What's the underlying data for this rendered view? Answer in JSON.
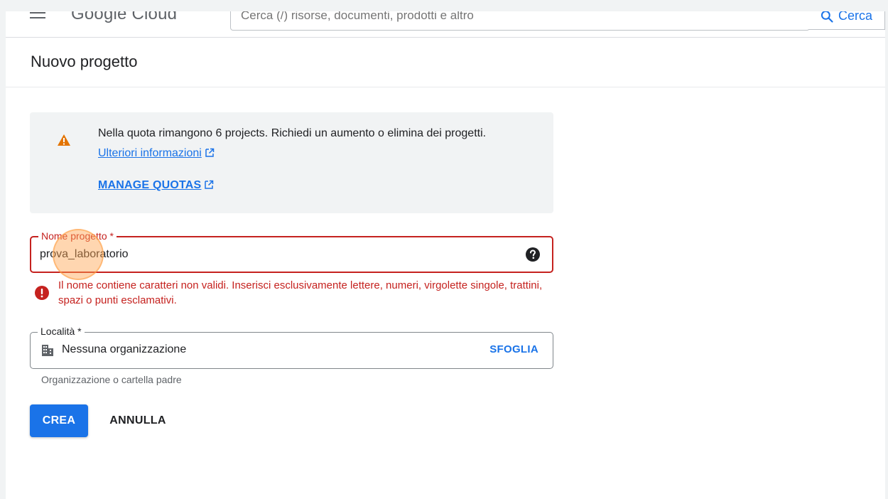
{
  "header": {
    "logo_text": "Google Cloud",
    "search_placeholder": "Cerca (/) risorse, documenti, prodotti e altro",
    "search_button_label": "Cerca"
  },
  "page": {
    "title": "Nuovo progetto"
  },
  "quota_warning": {
    "text": "Nella quota rimangono 6 projects. Richiedi un aumento o elimina dei progetti.",
    "link_label": "Ulteriori informazioni",
    "manage_label": "MANAGE QUOTAS"
  },
  "project_name": {
    "label": "Nome progetto *",
    "value": "prova_laboratorio",
    "error": "Il nome contiene caratteri non validi. Inserisci esclusivamente lettere, numeri, virgolette singole, trattini, spazi o punti esclamativi."
  },
  "location": {
    "label": "Località *",
    "value": "Nessuna organizzazione",
    "browse_label": "SFOGLIA",
    "hint": "Organizzazione o cartella padre"
  },
  "actions": {
    "create_label": "CREA",
    "cancel_label": "ANNULLA"
  },
  "icons": {
    "menu": "hamburger-menu-icon",
    "search": "search-icon",
    "warning": "warning-triangle-icon",
    "external": "external-link-icon",
    "help": "help-circle-icon",
    "error": "error-circle-icon",
    "organization": "organization-building-icon"
  },
  "colors": {
    "primary": "#1a73e8",
    "error": "#c5221f",
    "warning": "#e37400",
    "panel": "#f1f3f4"
  }
}
